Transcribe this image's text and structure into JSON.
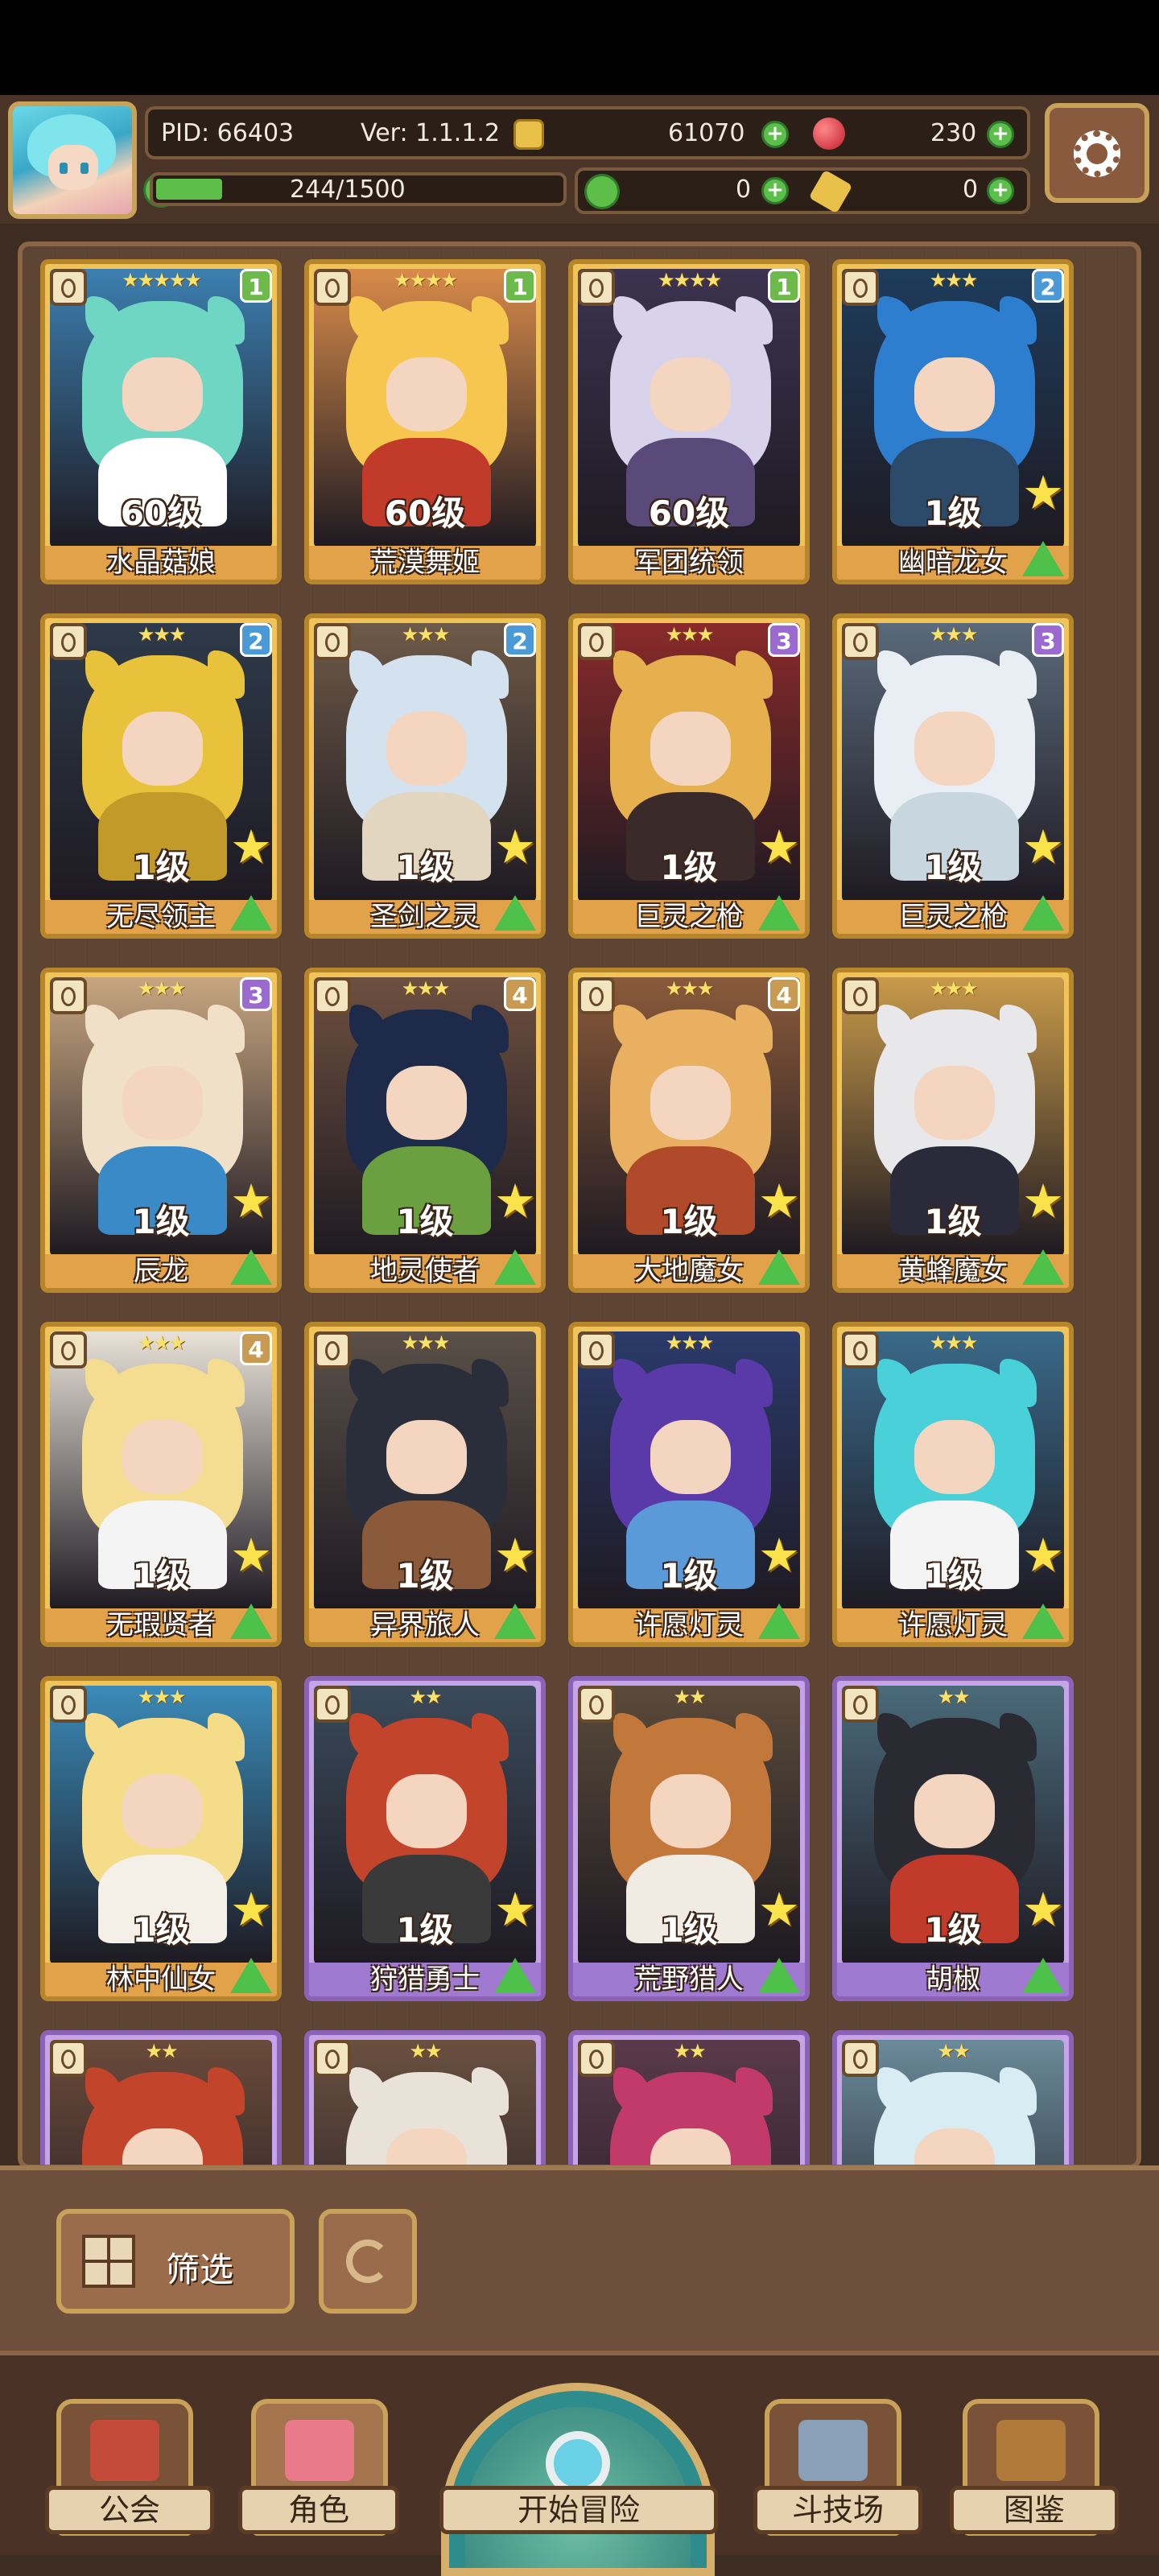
{
  "hud": {
    "pid": "PID: 66403",
    "version": "Ver: 1.1.1.2",
    "gold": "61070",
    "gems": "230",
    "exp": "244/1500",
    "exp_progress": 0.163,
    "clover": "0",
    "keys": "0"
  },
  "cards": [
    {
      "name": "水晶菇娘",
      "level": "60级",
      "stars": "★★★★★",
      "badge": "1",
      "frame": "gold",
      "hair": "#6fd6c4",
      "body": "#ffffff",
      "bg": "#3c7fb0"
    },
    {
      "name": "荒漠舞姬",
      "level": "60级",
      "stars": "★★★★",
      "badge": "1",
      "frame": "gold",
      "hair": "#f6c64e",
      "body": "#c23a2a",
      "bg": "#d98b4a"
    },
    {
      "name": "军团统领",
      "level": "60级",
      "stars": "★★★★",
      "badge": "1",
      "frame": "gold",
      "hair": "#d8d2ea",
      "body": "#5a4a7a",
      "bg": "#3c3350"
    },
    {
      "name": "幽暗龙女",
      "level": "1级",
      "stars": "★★★",
      "badge": "2",
      "frame": "gold",
      "hair": "#2e7ed0",
      "body": "#2c4a6a",
      "bg": "#1e3c5c"
    },
    {
      "name": "无尽领主",
      "level": "1级",
      "stars": "★★★",
      "badge": "2",
      "frame": "gold",
      "hair": "#e8c23a",
      "body": "#c29a2a",
      "bg": "#2e3a4a"
    },
    {
      "name": "圣剑之灵",
      "level": "1级",
      "stars": "★★★",
      "badge": "2",
      "frame": "gold",
      "hair": "#d4e2f0",
      "body": "#e2d6c0",
      "bg": "#6e5a48"
    },
    {
      "name": "巨灵之枪",
      "level": "1级",
      "stars": "★★★",
      "badge": "3",
      "frame": "gold",
      "hair": "#e6b04e",
      "body": "#3a2a2a",
      "bg": "#8a2a2a"
    },
    {
      "name": "巨灵之枪",
      "level": "1级",
      "stars": "★★★",
      "badge": "3",
      "frame": "gold",
      "hair": "#e8eef4",
      "body": "#c8d6e0",
      "bg": "#5a6a7a"
    },
    {
      "name": "辰龙",
      "level": "1级",
      "stars": "★★★",
      "badge": "3",
      "frame": "gold",
      "hair": "#f0e0c8",
      "body": "#3a8ac8",
      "bg": "#c8a680"
    },
    {
      "name": "地灵使者",
      "level": "1级",
      "stars": "★★★",
      "badge": "4",
      "frame": "gold",
      "hair": "#1e2a4a",
      "body": "#6aa040",
      "bg": "#6e5040"
    },
    {
      "name": "大地魔女",
      "level": "1级",
      "stars": "★★★",
      "badge": "4",
      "frame": "gold",
      "hair": "#e8b060",
      "body": "#b04a2a",
      "bg": "#8a5a3a"
    },
    {
      "name": "黄蜂魔女",
      "level": "1级",
      "stars": "★★★",
      "badge": "",
      "frame": "gold",
      "hair": "#e8e8ea",
      "body": "#2a2a3a",
      "bg": "#c89a4a"
    },
    {
      "name": "无瑕贤者",
      "level": "1级",
      "stars": "★★★",
      "badge": "4",
      "frame": "gold",
      "hair": "#f4dc90",
      "body": "#f4f4f4",
      "bg": "#e8e2d8"
    },
    {
      "name": "异界旅人",
      "level": "1级",
      "stars": "★★★",
      "badge": "",
      "frame": "gold",
      "hair": "#2a2e3a",
      "body": "#8a5a3a",
      "bg": "#5a5048"
    },
    {
      "name": "许愿灯灵",
      "level": "1级",
      "stars": "★★★",
      "badge": "",
      "frame": "gold",
      "hair": "#5a3aa8",
      "body": "#5a9ad8",
      "bg": "#2a3a6a"
    },
    {
      "name": "许愿灯灵",
      "level": "1级",
      "stars": "★★★",
      "badge": "",
      "frame": "gold",
      "hair": "#4ad0d8",
      "body": "#f4f4f4",
      "bg": "#3a6a8a"
    },
    {
      "name": "林中仙女",
      "level": "1级",
      "stars": "★★★",
      "badge": "",
      "frame": "gold",
      "hair": "#f4dc88",
      "body": "#f4f0e8",
      "bg": "#3a8ab8"
    },
    {
      "name": "狩猎勇士",
      "level": "1级",
      "stars": "★★",
      "badge": "",
      "frame": "purple",
      "hair": "#c2442a",
      "body": "#3a3a3a",
      "bg": "#3a4a5a"
    },
    {
      "name": "荒野猎人",
      "level": "1级",
      "stars": "★★",
      "badge": "",
      "frame": "purple",
      "hair": "#c2783a",
      "body": "#f0ece4",
      "bg": "#5a4a3a"
    },
    {
      "name": "胡椒",
      "level": "1级",
      "stars": "★★",
      "badge": "",
      "frame": "purple",
      "hair": "#2a2a32",
      "body": "#c23a2a",
      "bg": "#4a6a7a"
    },
    {
      "name": "",
      "level": "",
      "stars": "★★",
      "badge": "",
      "frame": "purple",
      "hair": "#c2442a",
      "body": "#6a3a2a",
      "bg": "#6a4a3a"
    },
    {
      "name": "",
      "level": "",
      "stars": "★★",
      "badge": "",
      "frame": "purple",
      "hair": "#e8e2d8",
      "body": "#2a4a6a",
      "bg": "#6a5040"
    },
    {
      "name": "",
      "level": "",
      "stars": "★★",
      "badge": "",
      "frame": "purple",
      "hair": "#c23a6a",
      "body": "#6a3a5a",
      "bg": "#5a3a4a"
    },
    {
      "name": "",
      "level": "",
      "stars": "★★",
      "badge": "",
      "frame": "purple",
      "hair": "#d8ecf4",
      "body": "#c8e0ec",
      "bg": "#6a8a9a"
    }
  ],
  "controls": {
    "filter_label": "筛选"
  },
  "nav": [
    {
      "label": "公会",
      "icon": "guild-icon",
      "color": "#c44a3a"
    },
    {
      "label": "角色",
      "icon": "character-icon",
      "color": "#e87a8a"
    },
    {
      "label": "开始冒险",
      "icon": "adventure-icon",
      "color": "#2e8c8c"
    },
    {
      "label": "斗技场",
      "icon": "arena-icon",
      "color": "#8aa0b8"
    },
    {
      "label": "图鉴",
      "icon": "collection-icon",
      "color": "#b07a3a"
    }
  ]
}
